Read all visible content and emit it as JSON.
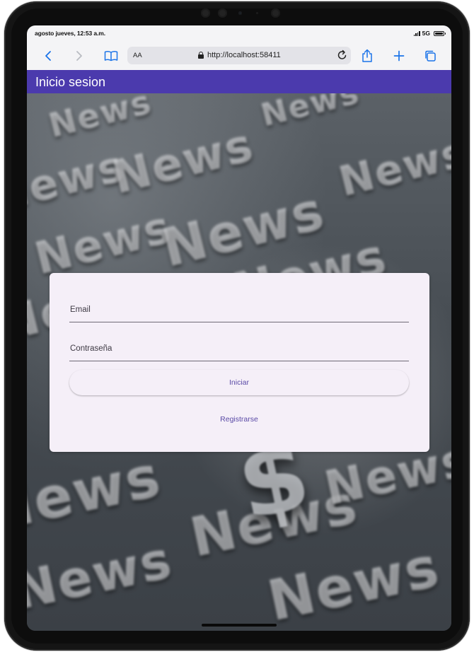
{
  "status_bar": {
    "time": "agosto jueves, 12:53 a.m.",
    "network": "5G"
  },
  "browser": {
    "text_size_label": "AA",
    "url": "http://localhost:58411",
    "icons": {
      "back": "chevron-left-icon",
      "forward": "chevron-right-icon",
      "bookmarks": "book-icon",
      "secure": "lock-icon",
      "reload": "reload-icon",
      "share": "share-icon",
      "new_tab": "plus-icon",
      "tabs": "tabs-icon"
    },
    "accent_color": "#1a73e8"
  },
  "app_bar": {
    "title": "Inicio sesion",
    "color": "#4b3aad"
  },
  "background": {
    "word": "News",
    "symbol": "$"
  },
  "login_form": {
    "email_label": "Email",
    "email_value": "",
    "password_label": "Contraseña",
    "password_value": "",
    "login_button": "Iniciar",
    "register_button": "Registrarse",
    "card_color": "#f5eff8",
    "button_text_color": "#5a4aa6"
  }
}
